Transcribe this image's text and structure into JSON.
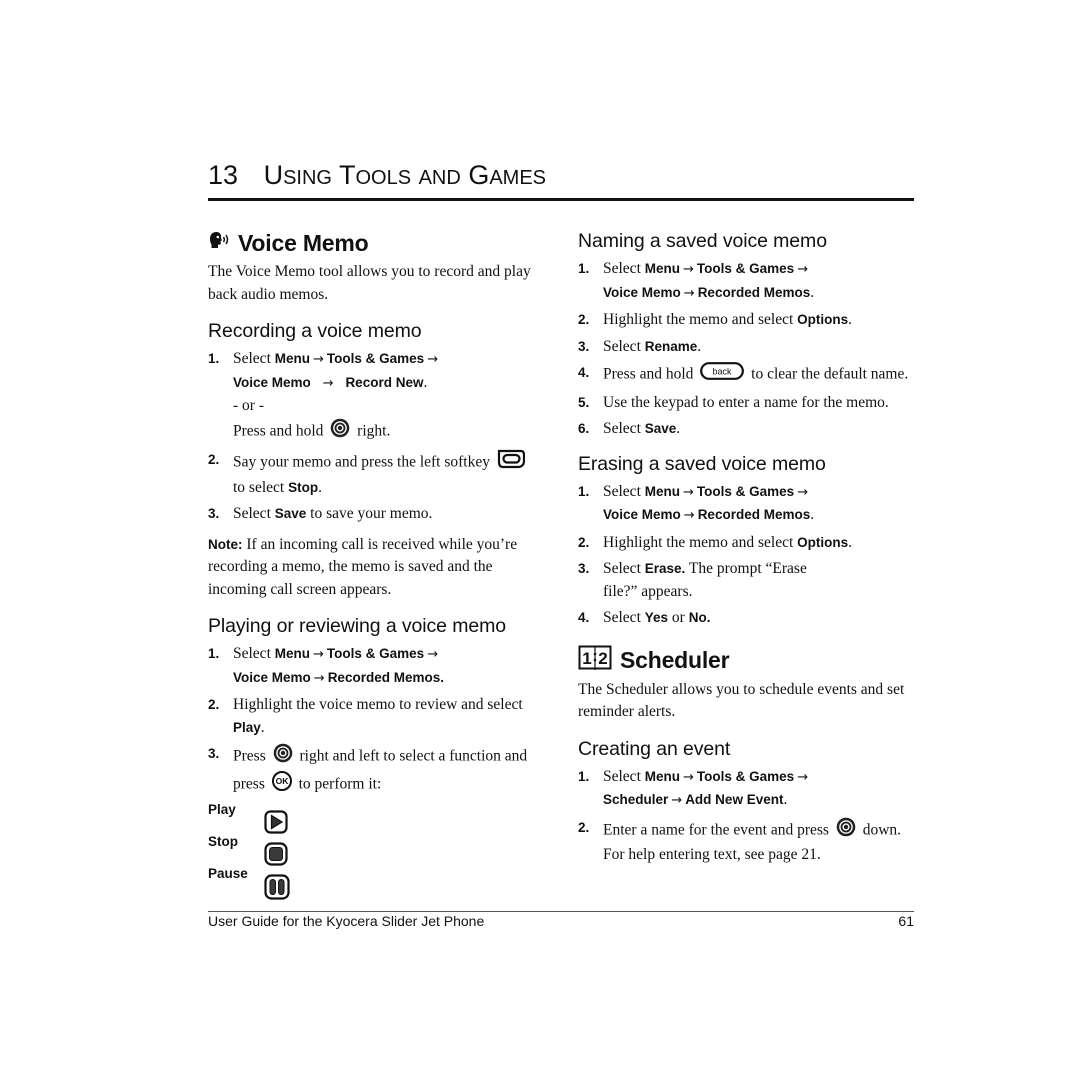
{
  "chapter": {
    "number": "13",
    "title_parts": [
      {
        "cap": "U",
        "rest": "SING"
      },
      {
        "cap": "T",
        "rest": "OOLS"
      },
      {
        "cap": "",
        "rest": "AND"
      },
      {
        "cap": "G",
        "rest": "AMES"
      }
    ]
  },
  "voice_memo": {
    "icon": "voice-memo-speaking-head-icon",
    "title": "Voice Memo",
    "intro": "The Voice Memo tool allows you to record and play back audio memos.",
    "recording": {
      "heading": "Recording a voice memo",
      "steps": [
        {
          "n": "1.",
          "select": "Select",
          "menu": "Menu",
          "arrow": "→",
          "tools": "Tools & Games",
          "vm": "Voice Memo",
          "rec": "Record New",
          "or": "- or -",
          "press_hold": "Press and hold",
          "right": "right."
        },
        {
          "n": "2.",
          "text1": "Say your memo and press the left softkey",
          "text2": "to select",
          "bold": "Stop"
        },
        {
          "n": "3.",
          "select": "Select",
          "bold": "Save",
          "rest": "to save your memo."
        }
      ]
    },
    "note": {
      "label": "Note:",
      "text": "If an incoming call is received while you’re recording a memo, the memo is saved and the incoming call screen appears."
    },
    "playing": {
      "heading": "Playing or reviewing a voice memo",
      "steps": [
        {
          "n": "1.",
          "select": "Select",
          "menu": "Menu",
          "tools": "Tools & Games",
          "vm": "Voice Memo",
          "rec": "Recorded Memos."
        },
        {
          "n": "2.",
          "text": "Highlight the voice memo to review and select",
          "bold": "Play"
        },
        {
          "n": "3.",
          "press": "Press",
          "mid": "right and left to select a function and press",
          "end": "to perform it:"
        }
      ],
      "functions": [
        {
          "label": "Play",
          "icon": "play-icon"
        },
        {
          "label": "Stop",
          "icon": "stop-icon"
        },
        {
          "label": "Pause",
          "icon": "pause-icon"
        }
      ]
    }
  },
  "naming": {
    "heading": "Naming a saved voice memo",
    "steps": [
      {
        "n": "1.",
        "select": "Select",
        "menu": "Menu",
        "tools": "Tools & Games",
        "vm": "Voice Memo",
        "rec": "Recorded Memos"
      },
      {
        "n": "2.",
        "text": "Highlight the memo and select",
        "bold": "Options"
      },
      {
        "n": "3.",
        "select": "Select",
        "bold": "Rename"
      },
      {
        "n": "4.",
        "text1": "Press and hold",
        "key": "back",
        "text2": "to clear the default name."
      },
      {
        "n": "5.",
        "text": "Use the keypad to enter a name for the memo."
      },
      {
        "n": "6.",
        "select": "Select",
        "bold": "Save"
      }
    ]
  },
  "erasing": {
    "heading": "Erasing a saved voice memo",
    "steps": [
      {
        "n": "1.",
        "select": "Select",
        "menu": "Menu",
        "tools": "Tools & Games",
        "vm": "Voice Memo",
        "rec": "Recorded Memos"
      },
      {
        "n": "2.",
        "text": "Highlight the memo and select",
        "bold": "Options"
      },
      {
        "n": "3.",
        "select": "Select",
        "bold": "Erase.",
        "rest": "The prompt “Erase file?” appears."
      },
      {
        "n": "4.",
        "select": "Select",
        "yes": "Yes",
        "or": "or",
        "no": "No."
      }
    ]
  },
  "scheduler": {
    "icon": "scheduler-calendar-icon",
    "title": "Scheduler",
    "intro": "The Scheduler allows you to schedule events and set reminder alerts.",
    "creating": {
      "heading": "Creating an event",
      "steps": [
        {
          "n": "1.",
          "select": "Select",
          "menu": "Menu",
          "tools": "Tools & Games",
          "sched": "Scheduler",
          "add": "Add New Event"
        },
        {
          "n": "2.",
          "text1": "Enter a name for the event and press",
          "text2": "down. For help entering text, see page 21."
        }
      ]
    }
  },
  "footer": {
    "text": "User Guide for the Kyocera Slider Jet Phone",
    "page": "61"
  }
}
